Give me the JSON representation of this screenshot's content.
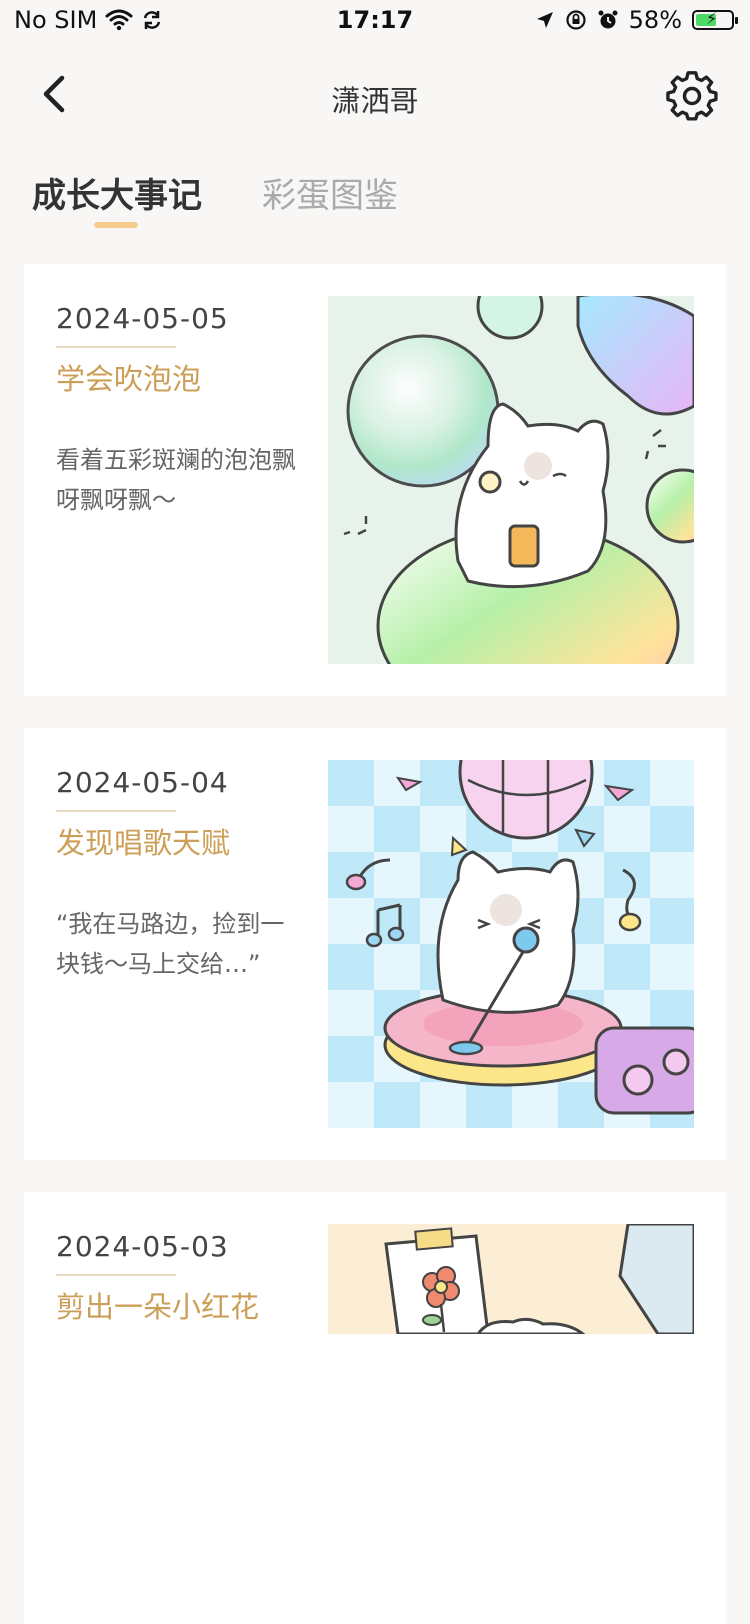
{
  "status_bar": {
    "carrier": "No SIM",
    "time": "17:17",
    "battery_percent": "58%",
    "battery_level": 0.58
  },
  "nav": {
    "title": "潇洒哥"
  },
  "tabs": [
    {
      "label": "成长大事记",
      "active": true
    },
    {
      "label": "彩蛋图鉴",
      "active": false
    }
  ],
  "events": [
    {
      "date": "2024-05-05",
      "title": "学会吹泡泡",
      "description": "看着五彩斑斓的泡泡飘呀飘呀飘～",
      "image_icon": "cat-blowing-bubbles-illustration"
    },
    {
      "date": "2024-05-04",
      "title": "发现唱歌天赋",
      "description": "“我在马路边，捡到一块钱～马上交给…”",
      "image_icon": "cat-singing-illustration"
    },
    {
      "date": "2024-05-03",
      "title": "剪出一朵小红花",
      "description": "",
      "image_icon": "cat-paper-flower-illustration"
    }
  ],
  "colors": {
    "accent": "#cc9f58",
    "tab_underline": "#f5cc8a",
    "background": "#f8f7f5"
  }
}
